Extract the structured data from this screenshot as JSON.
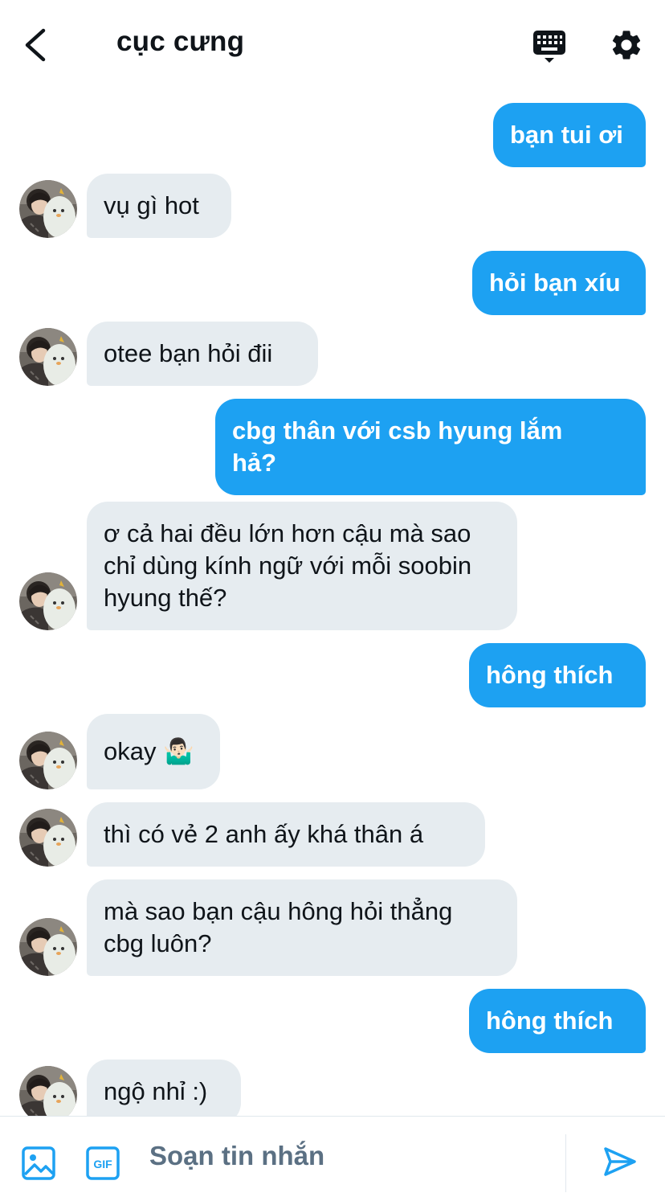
{
  "header": {
    "title": "cục cưng",
    "back_icon": "chevron-left-icon",
    "keyboard_icon": "keyboard-icon",
    "settings_icon": "gear-icon"
  },
  "messages": [
    {
      "from": "me",
      "text": "bạn tui ơi"
    },
    {
      "from": "them",
      "text": "vụ gì hot"
    },
    {
      "from": "me",
      "text": "hỏi bạn xíu"
    },
    {
      "from": "them",
      "text": "otee bạn hỏi đii"
    },
    {
      "from": "me",
      "text": "cbg thân với csb hyung lắm hả?"
    },
    {
      "from": "them",
      "text": "ơ cả hai đều lớn hơn cậu mà sao chỉ dùng kính ngữ với mỗi soobin hyung thế?"
    },
    {
      "from": "me",
      "text": "hông thích"
    },
    {
      "from": "them",
      "text": "okay 🤷🏻‍♂️"
    },
    {
      "from": "them",
      "text": "thì có vẻ 2 anh ấy khá thân á"
    },
    {
      "from": "them",
      "text": "mà sao bạn cậu hông hỏi thẳng cbg luôn?"
    },
    {
      "from": "me",
      "text": "hông thích"
    },
    {
      "from": "them",
      "text": "ngộ nhỉ :)"
    }
  ],
  "composer": {
    "placeholder": "Soạn tin nhắn",
    "value": "",
    "image_icon": "image-icon",
    "gif_label": "GIF",
    "send_icon": "send-icon"
  },
  "colors": {
    "accent": "#1da1f2",
    "received_bubble": "#e6ecf0",
    "text": "#0f1419",
    "muted": "#5b7083"
  }
}
